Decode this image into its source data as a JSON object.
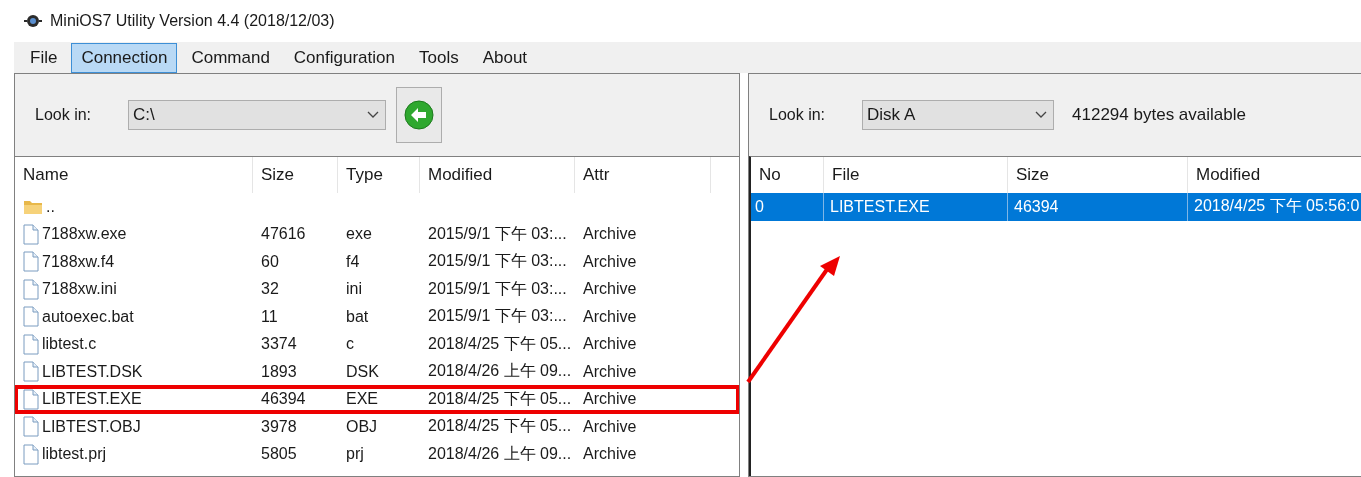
{
  "window": {
    "title": "MiniOS7 Utility Version 4.4 (2018/12/03)"
  },
  "menu": [
    {
      "label": "File",
      "selected": false
    },
    {
      "label": "Connection",
      "selected": true
    },
    {
      "label": "Command",
      "selected": false
    },
    {
      "label": "Configuration",
      "selected": false
    },
    {
      "label": "Tools",
      "selected": false
    },
    {
      "label": "About",
      "selected": false
    }
  ],
  "local": {
    "look_in_label": "Look in:",
    "drive": "C:\\",
    "columns": [
      "Name",
      "Size",
      "Type",
      "Modified",
      "Attr"
    ],
    "rows": [
      {
        "kind": "folder",
        "name": "..",
        "selected": false,
        "highlighted": false
      },
      {
        "kind": "file",
        "name": "7188xw.exe",
        "size": "47616",
        "type": "exe",
        "modified": "2015/9/1 下午 03:...",
        "attr": "Archive",
        "selected": false,
        "highlighted": false
      },
      {
        "kind": "file",
        "name": "7188xw.f4",
        "size": "60",
        "type": "f4",
        "modified": "2015/9/1 下午 03:...",
        "attr": "Archive",
        "selected": false,
        "highlighted": false
      },
      {
        "kind": "file",
        "name": "7188xw.ini",
        "size": "32",
        "type": "ini",
        "modified": "2015/9/1 下午 03:...",
        "attr": "Archive",
        "selected": false,
        "highlighted": false
      },
      {
        "kind": "file",
        "name": "autoexec.bat",
        "size": "11",
        "type": "bat",
        "modified": "2015/9/1 下午 03:...",
        "attr": "Archive",
        "selected": false,
        "highlighted": false
      },
      {
        "kind": "file",
        "name": "libtest.c",
        "size": "3374",
        "type": "c",
        "modified": "2018/4/25 下午 05...",
        "attr": "Archive",
        "selected": false,
        "highlighted": false
      },
      {
        "kind": "file",
        "name": "LIBTEST.DSK",
        "size": "1893",
        "type": "DSK",
        "modified": "2018/4/26 上午 09...",
        "attr": "Archive",
        "selected": false,
        "highlighted": false
      },
      {
        "kind": "file",
        "name": "LIBTEST.EXE",
        "size": "46394",
        "type": "EXE",
        "modified": "2018/4/25 下午 05...",
        "attr": "Archive",
        "selected": false,
        "highlighted": true
      },
      {
        "kind": "file",
        "name": "LIBTEST.OBJ",
        "size": "3978",
        "type": "OBJ",
        "modified": "2018/4/25 下午 05...",
        "attr": "Archive",
        "selected": false,
        "highlighted": false
      },
      {
        "kind": "file",
        "name": "libtest.prj",
        "size": "5805",
        "type": "prj",
        "modified": "2018/4/26 上午 09...",
        "attr": "Archive",
        "selected": false,
        "highlighted": false
      }
    ]
  },
  "module": {
    "look_in_label": "Look in:",
    "drive": "Disk A",
    "available": "412294 bytes available",
    "columns": [
      "No",
      "File",
      "Size",
      "Modified"
    ],
    "rows": [
      {
        "no": "0",
        "file": "LIBTEST.EXE",
        "size": "46394",
        "modified": "2018/4/25 下午 05:56:0",
        "selected": true
      }
    ]
  }
}
